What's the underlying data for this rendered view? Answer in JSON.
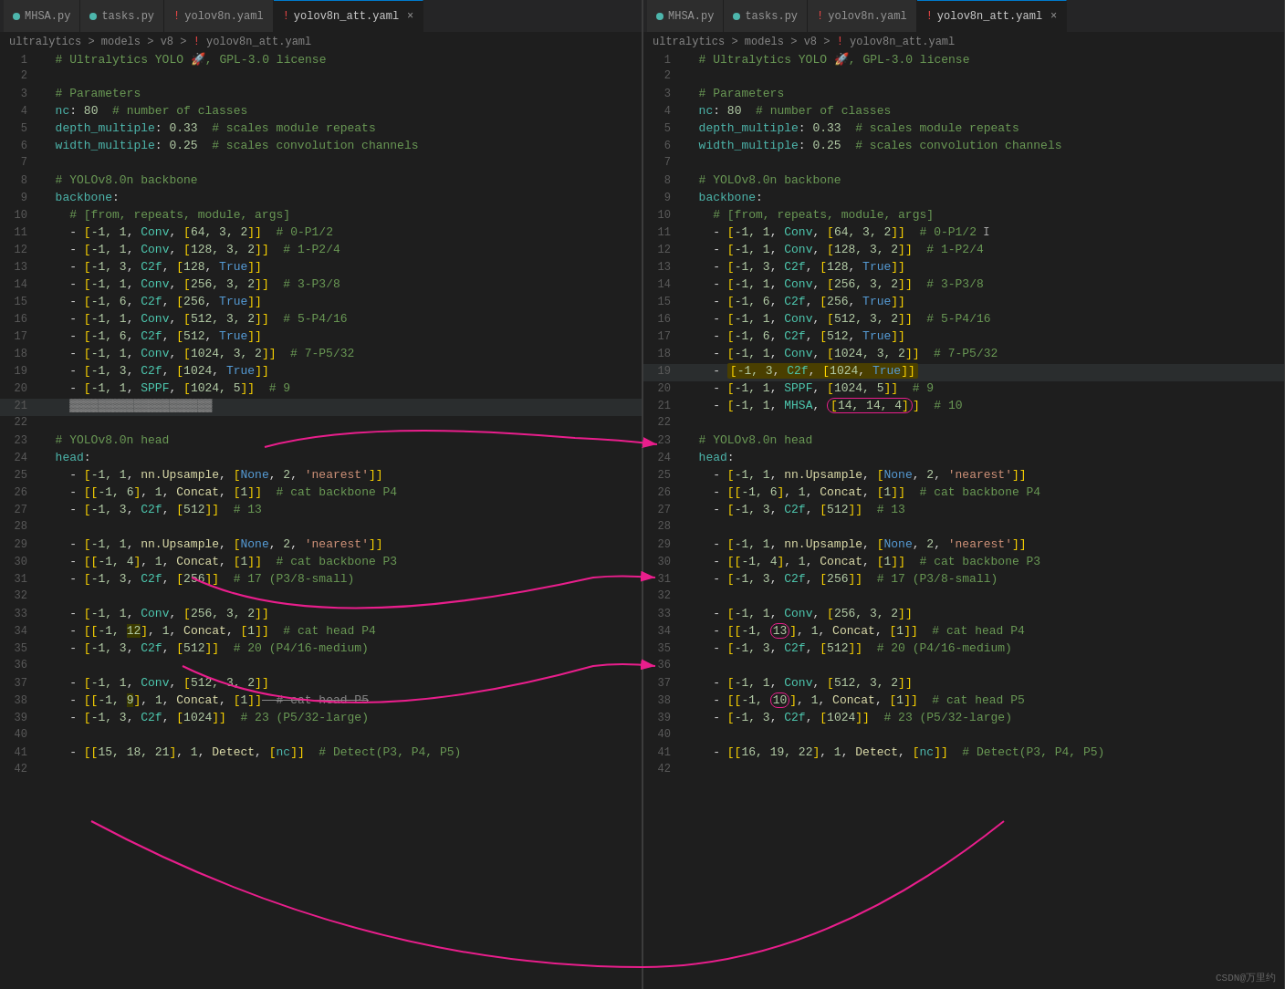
{
  "panels": [
    {
      "id": "left",
      "tabs": [
        {
          "label": "MHSA.py",
          "icon": "blue-dot",
          "active": false
        },
        {
          "label": "tasks.py",
          "icon": "blue-dot",
          "active": false
        },
        {
          "label": "yolov8n.yaml",
          "icon": "exclaim",
          "active": false
        },
        {
          "label": "yolov8n_att.yaml",
          "icon": "exclaim",
          "active": true,
          "closeable": true
        }
      ],
      "breadcrumb": "ultralytics > models > v8 > ! yolov8n_att.yaml",
      "lines": [
        {
          "num": 1,
          "content": "  # Ultralytics YOLO 🚀, GPL-3.0 license",
          "type": "comment"
        },
        {
          "num": 2,
          "content": ""
        },
        {
          "num": 3,
          "content": "  # Parameters",
          "type": "comment"
        },
        {
          "num": 4,
          "content": "  nc: 80  # number of classes"
        },
        {
          "num": 5,
          "content": "  depth_multiple: 0.33  # scales module repeats"
        },
        {
          "num": 6,
          "content": "  width_multiple: 0.25  # scales convolution channels"
        },
        {
          "num": 7,
          "content": ""
        },
        {
          "num": 8,
          "content": "  # YOLOv8.0n backbone",
          "type": "comment"
        },
        {
          "num": 9,
          "content": "  backbone:"
        },
        {
          "num": 10,
          "content": "    # [from, repeats, module, args]",
          "type": "comment"
        },
        {
          "num": 11,
          "content": "    - [-1, 1, Conv, [64, 3, 2]]  # 0-P1/2"
        },
        {
          "num": 12,
          "content": "    - [-1, 1, Conv, [128, 3, 2]]  # 1-P2/4"
        },
        {
          "num": 13,
          "content": "    - [-1, 3, C2f, [128, True]]"
        },
        {
          "num": 14,
          "content": "    - [-1, 1, Conv, [256, 3, 2]]  # 3-P3/8"
        },
        {
          "num": 15,
          "content": "    - [-1, 6, C2f, [256, True]]"
        },
        {
          "num": 16,
          "content": "    - [-1, 1, Conv, [512, 3, 2]]  # 5-P4/16"
        },
        {
          "num": 17,
          "content": "    - [-1, 6, C2f, [512, True]]"
        },
        {
          "num": 18,
          "content": "    - [-1, 1, Conv, [1024, 3, 2]]  # 7-P5/32"
        },
        {
          "num": 19,
          "content": "    - [-1, 3, C2f, [1024, True]]"
        },
        {
          "num": 20,
          "content": "    - [-1, 1, SPPF, [1024, 5]]  # 9"
        },
        {
          "num": 21,
          "content": "    "
        },
        {
          "num": 22,
          "content": ""
        },
        {
          "num": 23,
          "content": "  # YOLOv8.0n head",
          "type": "comment"
        },
        {
          "num": 24,
          "content": "  head:"
        },
        {
          "num": 25,
          "content": "    - [-1, 1, nn.Upsample, [None, 2, 'nearest']]"
        },
        {
          "num": 26,
          "content": "    - [[-1, 6], 1, Concat, [1]]  # cat backbone P4"
        },
        {
          "num": 27,
          "content": "    - [-1, 3, C2f, [512]]  # 13"
        },
        {
          "num": 28,
          "content": ""
        },
        {
          "num": 29,
          "content": "    - [-1, 1, nn.Upsample, [None, 2, 'nearest']]"
        },
        {
          "num": 30,
          "content": "    - [[-1, 4], 1, Concat, [1]]  # cat backbone P3"
        },
        {
          "num": 31,
          "content": "    - [-1, 3, C2f, [256]]  # 17 (P3/8-small)"
        },
        {
          "num": 32,
          "content": ""
        },
        {
          "num": 33,
          "content": "    - [-1, 1, Conv, [256, 3, 2]]"
        },
        {
          "num": 34,
          "content": "    - [[-1, 12], 1, Concat, [1]]  # cat head P4"
        },
        {
          "num": 35,
          "content": "    - [-1, 3, C2f, [512]]  # 20 (P4/16-medium)"
        },
        {
          "num": 36,
          "content": ""
        },
        {
          "num": 37,
          "content": "    - [-1, 1, Conv, [512, 3, 2]]"
        },
        {
          "num": 38,
          "content": "    - [[-1, 9], 1, Concat, [1]]  # cat head P5"
        },
        {
          "num": 39,
          "content": "    - [-1, 3, C2f, [1024]]  # 23 (P5/32-large)"
        },
        {
          "num": 40,
          "content": ""
        },
        {
          "num": 41,
          "content": "    - [[15, 18, 21], 1, Detect, [nc]]  # Detect(P3, P4, P5)"
        },
        {
          "num": 42,
          "content": ""
        }
      ]
    },
    {
      "id": "right",
      "tabs": [
        {
          "label": "MHSA.py",
          "icon": "blue-dot",
          "active": false
        },
        {
          "label": "tasks.py",
          "icon": "blue-dot",
          "active": false
        },
        {
          "label": "yolov8n.yaml",
          "icon": "exclaim",
          "active": false
        },
        {
          "label": "yolov8n_att.yaml",
          "icon": "exclaim",
          "active": true,
          "closeable": true
        }
      ],
      "breadcrumb": "ultralytics > models > v8 > ! yolov8n_att.yaml",
      "lines": [
        {
          "num": 1,
          "content": "  # Ultralytics YOLO 🚀, GPL-3.0 license",
          "type": "comment"
        },
        {
          "num": 2,
          "content": ""
        },
        {
          "num": 3,
          "content": "  # Parameters",
          "type": "comment"
        },
        {
          "num": 4,
          "content": "  nc: 80  # number of classes"
        },
        {
          "num": 5,
          "content": "  depth_multiple: 0.33  # scales module repeats"
        },
        {
          "num": 6,
          "content": "  width_multiple: 0.25  # scales convolution channels"
        },
        {
          "num": 7,
          "content": ""
        },
        {
          "num": 8,
          "content": "  # YOLOv8.0n backbone",
          "type": "comment"
        },
        {
          "num": 9,
          "content": "  backbone:"
        },
        {
          "num": 10,
          "content": "    # [from, repeats, module, args]",
          "type": "comment"
        },
        {
          "num": 11,
          "content": "    - [-1, 1, Conv, [64, 3, 2]]  # 0-P1/2"
        },
        {
          "num": 12,
          "content": "    - [-1, 1, Conv, [128, 3, 2]]  # 1-P2/4"
        },
        {
          "num": 13,
          "content": "    - [-1, 3, C2f, [128, True]]"
        },
        {
          "num": 14,
          "content": "    - [-1, 1, Conv, [256, 3, 2]]  # 3-P3/8"
        },
        {
          "num": 15,
          "content": "    - [-1, 6, C2f, [256, True]]"
        },
        {
          "num": 16,
          "content": "    - [-1, 1, Conv, [512, 3, 2]]  # 5-P4/16"
        },
        {
          "num": 17,
          "content": "    - [-1, 6, C2f, [512, True]]"
        },
        {
          "num": 18,
          "content": "    - [-1, 1, Conv, [1024, 3, 2]]  # 7-P5/32"
        },
        {
          "num": 19,
          "content": "    - [-1, 3, C2f, [1024, True]]",
          "highlighted": true
        },
        {
          "num": 20,
          "content": "    - [-1, 1, SPPF, [1024, 5]]  # 9"
        },
        {
          "num": 21,
          "content": "    - [-1, 1, MHSA, [14, 14, 4]]  # 10"
        },
        {
          "num": 22,
          "content": ""
        },
        {
          "num": 23,
          "content": "  # YOLOv8.0n head",
          "type": "comment"
        },
        {
          "num": 24,
          "content": "  head:"
        },
        {
          "num": 25,
          "content": "    - [-1, 1, nn.Upsample, [None, 2, 'nearest']]"
        },
        {
          "num": 26,
          "content": "    - [[-1, 6], 1, Concat, [1]]  # cat backbone P4"
        },
        {
          "num": 27,
          "content": "    - [-1, 3, C2f, [512]]  # 13"
        },
        {
          "num": 28,
          "content": ""
        },
        {
          "num": 29,
          "content": "    - [-1, 1, nn.Upsample, [None, 2, 'nearest']]"
        },
        {
          "num": 30,
          "content": "    - [[-1, 4], 1, Concat, [1]]  # cat backbone P3"
        },
        {
          "num": 31,
          "content": "    - [-1, 3, C2f, [256]]  # 17 (P3/8-small)"
        },
        {
          "num": 32,
          "content": ""
        },
        {
          "num": 33,
          "content": "    - [-1, 1, Conv, [256, 3, 2]]"
        },
        {
          "num": 34,
          "content": "    - [[-1, 13], 1, Concat, [1]]  # cat head P4"
        },
        {
          "num": 35,
          "content": "    - [-1, 3, C2f, [512]]  # 20 (P4/16-medium)"
        },
        {
          "num": 36,
          "content": ""
        },
        {
          "num": 37,
          "content": "    - [-1, 1, Conv, [512, 3, 2]]"
        },
        {
          "num": 38,
          "content": "    - [[-1, 10], 1, Concat, [1]]  # cat head P5"
        },
        {
          "num": 39,
          "content": "    - [-1, 3, C2f, [1024]]  # 23 (P5/32-large)"
        },
        {
          "num": 40,
          "content": ""
        },
        {
          "num": 41,
          "content": "    - [[16, 19, 22], 1, Detect, [nc]]  # Detect(P3, P4, P5)"
        },
        {
          "num": 42,
          "content": ""
        }
      ]
    }
  ],
  "watermark": "CSDN@万里约"
}
